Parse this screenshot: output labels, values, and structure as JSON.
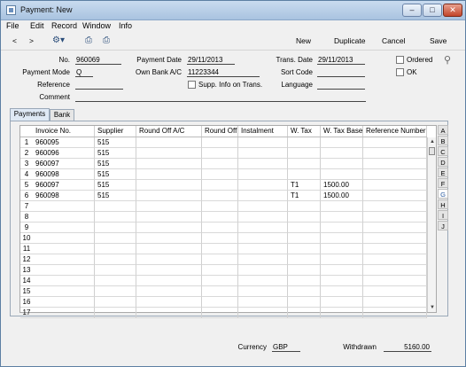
{
  "window": {
    "title": "Payment: New"
  },
  "menu": [
    "File",
    "Edit",
    "Record",
    "Window",
    "Info"
  ],
  "toolbar": {
    "back": "<",
    "forward": ">",
    "new": "New",
    "duplicate": "Duplicate",
    "cancel": "Cancel",
    "save": "Save"
  },
  "form": {
    "no_label": "No.",
    "no_value": "960069",
    "payment_mode_label": "Payment Mode",
    "payment_mode_value": "Q",
    "reference_label": "Reference",
    "reference_value": "",
    "comment_label": "Comment",
    "comment_value": "",
    "payment_date_label": "Payment Date",
    "payment_date_value": "29/11/2013",
    "own_bank_label": "Own Bank A/C",
    "own_bank_value": "11223344",
    "supp_info_label": "Supp. Info on Trans.",
    "trans_date_label": "Trans. Date",
    "trans_date_value": "29/11/2013",
    "sort_code_label": "Sort Code",
    "sort_code_value": "",
    "language_label": "Language",
    "language_value": "",
    "ordered_label": "Ordered",
    "ok_label": "OK"
  },
  "tabs": [
    "Payments",
    "Bank"
  ],
  "table": {
    "headers": [
      "Invoice No.",
      "Supplier",
      "Round Off A/C",
      "Round Off",
      "Instalment",
      "W. Tax",
      "W. Tax Base",
      "Reference Number"
    ],
    "row_numbers": [
      "1",
      "2",
      "3",
      "4",
      "5",
      "6",
      "7",
      "8",
      "9",
      "10",
      "11",
      "12",
      "13",
      "14",
      "15",
      "16",
      "17"
    ],
    "rows": [
      [
        "960095",
        "515",
        "",
        "",
        "",
        "",
        "",
        ""
      ],
      [
        "960096",
        "515",
        "",
        "",
        "",
        "",
        "",
        ""
      ],
      [
        "960097",
        "515",
        "",
        "",
        "",
        "",
        "",
        ""
      ],
      [
        "960098",
        "515",
        "",
        "",
        "",
        "",
        "",
        ""
      ],
      [
        "960097",
        "515",
        "",
        "",
        "",
        "T1",
        "1500.00",
        ""
      ],
      [
        "960098",
        "515",
        "",
        "",
        "",
        "T1",
        "1500.00",
        ""
      ]
    ]
  },
  "side_letters": [
    "A",
    "B",
    "C",
    "D",
    "E",
    "F",
    "G",
    "H",
    "I",
    "J"
  ],
  "footer": {
    "currency_label": "Currency",
    "currency_value": "GBP",
    "withdrawn_label": "Withdrawn",
    "withdrawn_value": "5160.00"
  }
}
